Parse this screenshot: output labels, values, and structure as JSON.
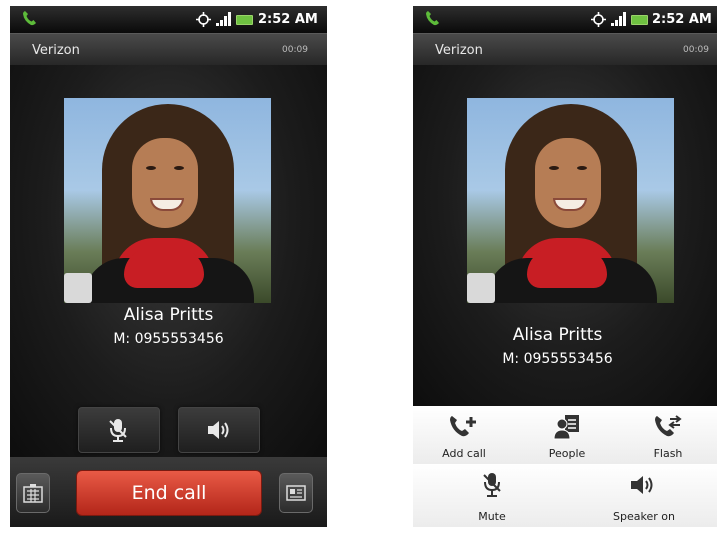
{
  "screens": [
    {
      "status": {
        "time": "2:52 AM"
      },
      "carrier": "Verizon",
      "duration": "00:09",
      "contact": {
        "name": "Alisa Pritts",
        "number": "M: 0955553456"
      },
      "end_call_label": "End call"
    },
    {
      "status": {
        "time": "2:52 AM"
      },
      "carrier": "Verizon",
      "duration": "00:09",
      "contact": {
        "name": "Alisa Pritts",
        "number": "M: 0955553456"
      },
      "options": {
        "add_call": "Add call",
        "people": "People",
        "flash": "Flash",
        "mute": "Mute",
        "speaker": "Speaker on"
      }
    }
  ],
  "icons": {
    "status_phone": "phone-icon",
    "gps": "gps-target-icon",
    "signal": "signal-icon",
    "battery": "battery-icon",
    "mute": "microphone-icon",
    "speaker": "speaker-icon",
    "dialpad": "dialpad-icon",
    "contact_card": "contact-card-icon"
  },
  "colors": {
    "end_call": "#d2412f",
    "battery": "#6fc241",
    "status_phone": "#5dbb3a"
  }
}
